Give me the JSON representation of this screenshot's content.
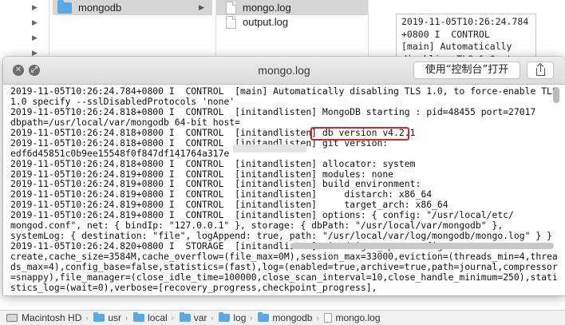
{
  "finder": {
    "selected_folder": "mongodb",
    "files": [
      "mongo.log",
      "output.log"
    ],
    "preview_lines": [
      "2019-11-05T10:26:24.784",
      "+0800 I  CONTROL",
      "[main] Automatically",
      "disabling TLS 1.0, to"
    ]
  },
  "quicklook": {
    "title": "mongo.log",
    "open_button": "使用“控制台”打开",
    "close_icon": "close-icon",
    "fullscreen_icon": "fullscreen-icon",
    "share_icon": "share-icon",
    "log_lines": [
      "2019-11-05T10:26:24.784+0800 I  CONTROL  [main] Automatically disabling TLS 1.0, to force-enable TLS",
      "1.0 specify --sslDisabledProtocols 'none'",
      "2019-11-05T10:26:24.818+0800 I  CONTROL  [initandlisten] MongoDB starting : pid=48455 port=27017",
      "dbpath=/usr/local/var/mongodb 64-bit host=",
      "2019-11-05T10:26:24.818+0800 I  CONTROL  [initandlisten] db version v4.2.1",
      "2019-11-05T10:26:24.818+0800 I  CONTROL  [initandlisten] git version:",
      "edf6d45851c0b9ee15548f0f847df141764a317e",
      "2019-11-05T10:26:24.818+0800 I  CONTROL  [initandlisten] allocator: system",
      "2019-11-05T10:26:24.819+0800 I  CONTROL  [initandlisten] modules: none",
      "2019-11-05T10:26:24.819+0800 I  CONTROL  [initandlisten] build environment:",
      "2019-11-05T10:26:24.819+0800 I  CONTROL  [initandlisten]     distarch: x86_64",
      "2019-11-05T10:26:24.819+0800 I  CONTROL  [initandlisten]     target_arch: x86_64",
      "2019-11-05T10:26:24.819+0800 I  CONTROL  [initandlisten] options: { config: \"/usr/local/etc/",
      "mongod.conf\", net: { bindIp: \"127.0.0.1\" }, storage: { dbPath: \"/usr/local/var/mongodb\" },",
      "systemLog: { destination: \"file\", logAppend: true, path: \"/usr/local/var/log/mongodb/mongo.log\" } }",
      "2019-11-05T10:26:24.820+0800 I  STORAGE  [initandlisten] wiredtiger_open config:",
      "create,cache_size=3584M,cache_overflow=(file_max=0M),session_max=33000,eviction=(threads_min=4,threa",
      "ds_max=4),config_base=false,statistics=(fast),log=(enabled=true,archive=true,path=journal,compressor",
      "=snappy),file_manager=(close_idle_time=100000,close_scan_interval=10,close_handle_minimum=250),stati",
      "stics_log=(wait=0),verbose=[recovery_progress,checkpoint_progress],"
    ],
    "highlight_color": "#d6282b"
  },
  "pathbar": {
    "crumbs": [
      "Macintosh HD",
      "usr",
      "local",
      "var",
      "log",
      "mongodb",
      "mongo.log"
    ]
  }
}
